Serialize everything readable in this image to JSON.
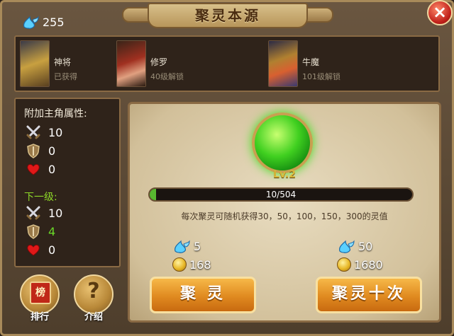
{
  "window": {
    "title": "聚灵本源",
    "close_glyph": "×"
  },
  "spirit_total": "255",
  "characters": [
    {
      "name": "神将",
      "status": "已获得",
      "portrait_icon": "general-portrait-icon"
    },
    {
      "name": "修罗",
      "status": "40级解锁",
      "portrait_icon": "asura-portrait-icon"
    },
    {
      "name": "牛魔",
      "status": "101级解锁",
      "portrait_icon": "bull-demon-portrait-icon"
    }
  ],
  "attributes": {
    "title": "附加主角属性:",
    "current": {
      "attack": "10",
      "defense": "0",
      "hp": "0"
    },
    "next_title": "下一级:",
    "next": {
      "attack": "10",
      "defense": "4",
      "hp": "0"
    }
  },
  "orb": {
    "level": "Lv.2",
    "progress_text": "10/504",
    "progress_fraction": 0.0198,
    "description": "每次聚灵可随机获得30，50，100，150，300的灵值"
  },
  "gather_once": {
    "spirit_cost": "5",
    "gold_cost": "168",
    "label": "聚 灵"
  },
  "gather_ten": {
    "spirit_cost": "50",
    "gold_cost": "1680",
    "label": "聚灵十次"
  },
  "bottom": {
    "rank_label": "排行",
    "rank_badge": "榜",
    "help_label": "介绍",
    "help_glyph": "?"
  },
  "colors": {
    "accent_orange": "#e08a20",
    "orb_green": "#40d020",
    "next_level_green": "#8ed828"
  }
}
